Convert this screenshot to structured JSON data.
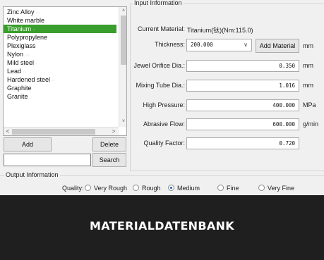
{
  "materials": {
    "items": [
      {
        "label": "Zinc Alloy",
        "suffix": "···"
      },
      {
        "label": "White marble",
        "suffix": ""
      },
      {
        "label": "Titanium",
        "suffix": "··",
        "selected": true
      },
      {
        "label": "Polypropylene",
        "suffix": ""
      },
      {
        "label": "Plexiglass",
        "suffix": ""
      },
      {
        "label": "Nylon",
        "suffix": "···"
      },
      {
        "label": "Mild steel",
        "suffix": "·"
      },
      {
        "label": "Lead",
        "suffix": "··"
      },
      {
        "label": "Hardened steel",
        "suffix": "··"
      },
      {
        "label": "Graphite",
        "suffix": ""
      },
      {
        "label": "Granite",
        "suffix": "··"
      }
    ],
    "scroll_up": "˄",
    "scroll_down": "˅",
    "scroll_left": "<",
    "scroll_right": ">"
  },
  "buttons": {
    "add": "Add",
    "delete": "Delete",
    "search": "Search"
  },
  "search": {
    "value": ""
  },
  "input_info": {
    "title": "Input Information",
    "current_material_label": "Current Material:",
    "current_material_value": "Titanium(钛)(Nm:115.0)",
    "thickness_label": "Thickness:",
    "thickness_value": "200.000",
    "add_material_button": "Add Material",
    "thickness_unit": "mm",
    "jewel_label": "Jewel Orifice Dia.:",
    "jewel_value": "0.350",
    "jewel_unit": "mm",
    "mixing_label": "Mixing Tube Dia.:",
    "mixing_value": "1.016",
    "mixing_unit": "mm",
    "pressure_label": "High Pressure:",
    "pressure_value": "400.000",
    "pressure_unit": "MPa",
    "abrasive_label": "Abrasive Flow:",
    "abrasive_value": "600.000",
    "abrasive_unit": "g/min",
    "quality_factor_label": "Quality Factor:",
    "quality_factor_value": "0.720"
  },
  "output_info": {
    "title": "Output Information",
    "quality_label": "Quality:",
    "options": [
      "Very Rough",
      "Rough",
      "Medium",
      "Fine",
      "Very Fine"
    ],
    "selected": "Medium"
  },
  "banner": {
    "title": "MATERIALDATENBANK"
  },
  "colors": {
    "selection": "#3a9e2c",
    "banner": "#1f1f1f",
    "radio_selected": "#1d5fb0"
  }
}
